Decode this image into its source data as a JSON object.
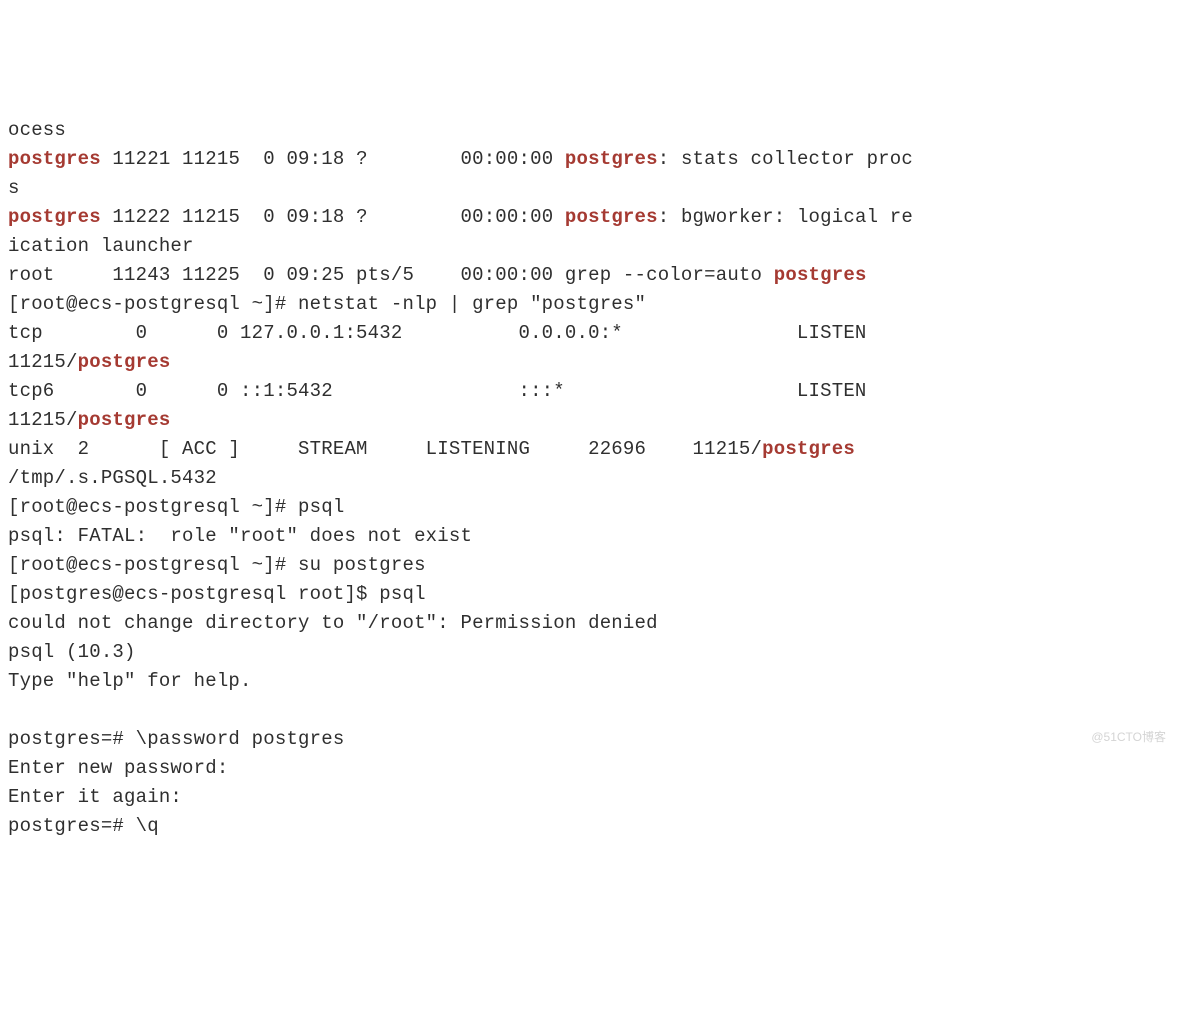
{
  "lines": [
    {
      "segs": [
        {
          "t": "ocess"
        }
      ]
    },
    {
      "segs": [
        {
          "t": "postgres",
          "c": "hl"
        },
        {
          "t": " 11221 11215  0 09:18 ?        00:00:00 "
        },
        {
          "t": "postgres",
          "c": "hl"
        },
        {
          "t": ": stats collector proc"
        }
      ]
    },
    {
      "segs": [
        {
          "t": "s"
        }
      ]
    },
    {
      "segs": [
        {
          "t": "postgres",
          "c": "hl"
        },
        {
          "t": " 11222 11215  0 09:18 ?        00:00:00 "
        },
        {
          "t": "postgres",
          "c": "hl"
        },
        {
          "t": ": bgworker: logical re"
        }
      ]
    },
    {
      "segs": [
        {
          "t": "ication launcher"
        }
      ]
    },
    {
      "segs": [
        {
          "t": "root     11243 11225  0 09:25 pts/5    00:00:00 grep --color=auto "
        },
        {
          "t": "postgres",
          "c": "hl"
        }
      ]
    },
    {
      "segs": [
        {
          "t": "[root@ecs-postgresql ~]# netstat -nlp | grep \"postgres\""
        }
      ]
    },
    {
      "segs": [
        {
          "t": "tcp        0      0 127.0.0.1:5432          0.0.0.0:*               LISTEN"
        }
      ]
    },
    {
      "segs": [
        {
          "t": "11215/"
        },
        {
          "t": "postgres",
          "c": "hl"
        }
      ]
    },
    {
      "segs": [
        {
          "t": "tcp6       0      0 ::1:5432                :::*                    LISTEN"
        }
      ]
    },
    {
      "segs": [
        {
          "t": "11215/"
        },
        {
          "t": "postgres",
          "c": "hl"
        }
      ]
    },
    {
      "segs": [
        {
          "t": "unix  2      [ ACC ]     STREAM     LISTENING     22696    11215/"
        },
        {
          "t": "postgres",
          "c": "hl"
        }
      ]
    },
    {
      "segs": [
        {
          "t": "/tmp/.s.PGSQL.5432"
        }
      ]
    },
    {
      "segs": [
        {
          "t": "[root@ecs-postgresql ~]# psql"
        }
      ]
    },
    {
      "segs": [
        {
          "t": "psql: FATAL:  role \"root\" does not exist"
        }
      ]
    },
    {
      "segs": [
        {
          "t": "[root@ecs-postgresql ~]# su postgres"
        }
      ]
    },
    {
      "segs": [
        {
          "t": "[postgres@ecs-postgresql root]$ psql"
        }
      ]
    },
    {
      "segs": [
        {
          "t": "could not change directory to \"/root\": Permission denied"
        }
      ]
    },
    {
      "segs": [
        {
          "t": "psql (10.3)"
        }
      ]
    },
    {
      "segs": [
        {
          "t": "Type \"help\" for help."
        }
      ]
    },
    {
      "segs": [
        {
          "t": " "
        }
      ]
    },
    {
      "segs": [
        {
          "t": "postgres=# \\password postgres"
        }
      ]
    },
    {
      "segs": [
        {
          "t": "Enter new password:"
        }
      ]
    },
    {
      "segs": [
        {
          "t": "Enter it again:"
        }
      ]
    },
    {
      "segs": [
        {
          "t": "postgres=# \\q"
        }
      ]
    }
  ],
  "watermark": "@51CTO博客"
}
